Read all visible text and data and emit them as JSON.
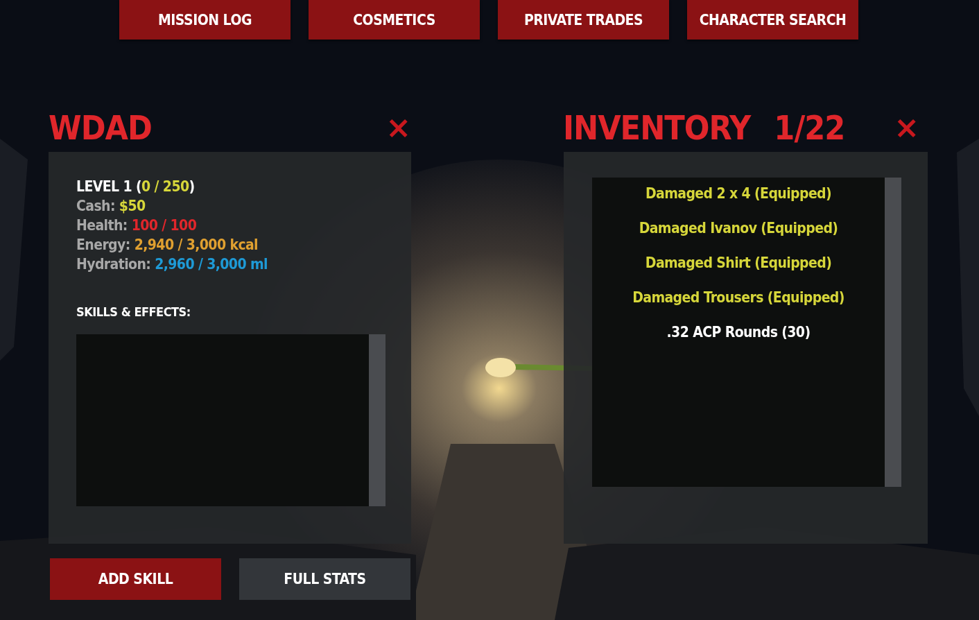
{
  "nav": [
    {
      "label": "MISSION LOG"
    },
    {
      "label": "COSMETICS"
    },
    {
      "label": "PRIVATE TRADES"
    },
    {
      "label": "CHARACTER SEARCH"
    }
  ],
  "character": {
    "title": "WDAD",
    "close": "×",
    "stats": [
      {
        "parts": [
          {
            "text": "LEVEL 1 (",
            "color": "#ffffff"
          },
          {
            "text": "0 / 250",
            "color": "#d6d63a"
          },
          {
            "text": ")",
            "color": "#ffffff"
          }
        ]
      },
      {
        "parts": [
          {
            "text": "Cash:",
            "color": "#a8a8a8"
          },
          {
            "text": " $50",
            "color": "#d6d63a"
          }
        ]
      },
      {
        "parts": [
          {
            "text": "Health:",
            "color": "#a8a8a8"
          },
          {
            "text": " 100 / 100",
            "color": "#e0262b"
          }
        ]
      },
      {
        "parts": [
          {
            "text": "Energy:",
            "color": "#a8a8a8"
          },
          {
            "text": " 2,940 / 3,000 kcal",
            "color": "#e0a030"
          }
        ]
      },
      {
        "parts": [
          {
            "text": "Hydration:",
            "color": "#a8a8a8"
          },
          {
            "text": " 2,960 / 3,000 ml",
            "color": "#1e9ad6"
          }
        ]
      }
    ],
    "skills_label": "SKILLS & EFFECTS:",
    "buttons": [
      {
        "label": "ADD SKILL",
        "kind": "primary"
      },
      {
        "label": "FULL STATS",
        "kind": "secondary"
      }
    ]
  },
  "inventory": {
    "title": "INVENTORY",
    "count": "1/22",
    "close": "×",
    "items": [
      {
        "name": "Damaged 2 x 4 (Equipped)",
        "equipped": true
      },
      {
        "name": "Damaged Ivanov (Equipped)",
        "equipped": true
      },
      {
        "name": "Damaged Shirt (Equipped)",
        "equipped": true
      },
      {
        "name": "Damaged Trousers (Equipped)",
        "equipped": true
      },
      {
        "name": ".32 ACP Rounds (30)",
        "equipped": false
      }
    ]
  }
}
